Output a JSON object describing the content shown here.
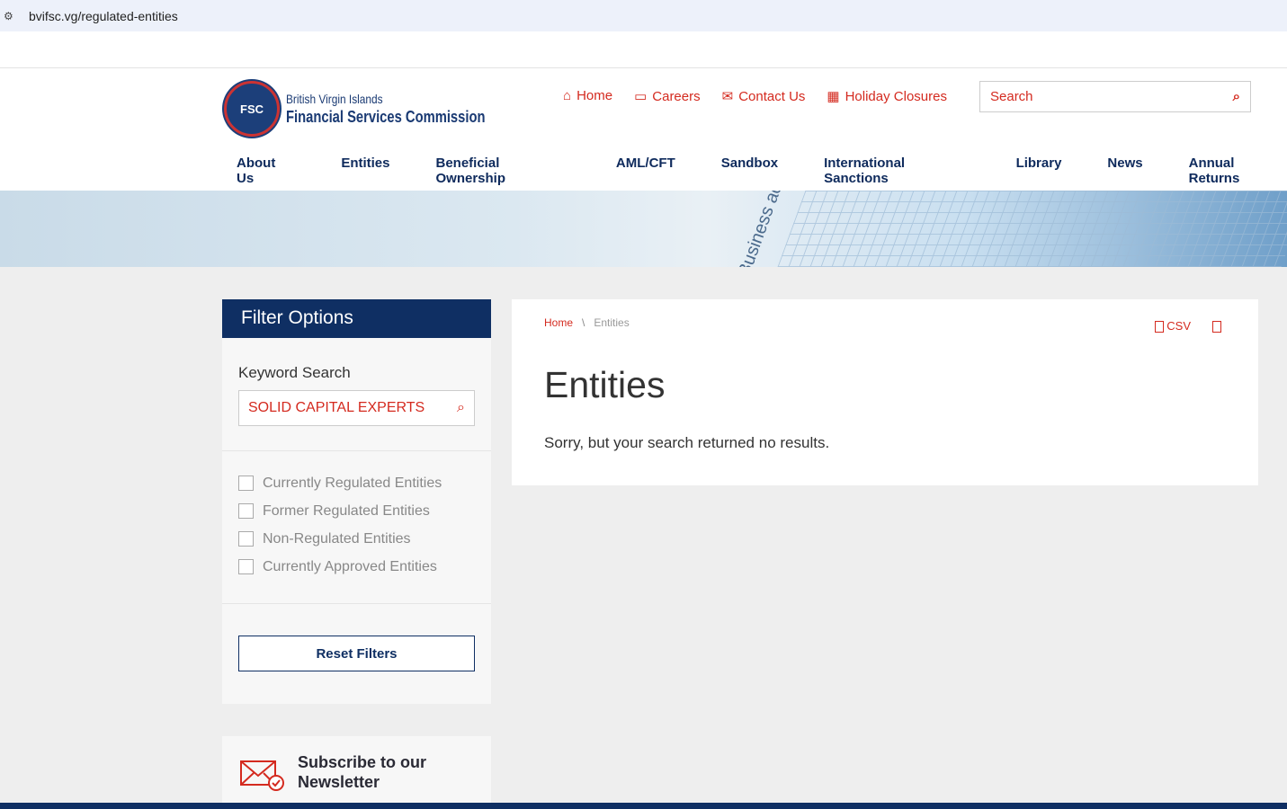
{
  "browser": {
    "url": "bvifsc.vg/regulated-entities"
  },
  "logo": {
    "seal": "FSC",
    "line1": "British Virgin Islands",
    "line2": "Financial Services Commission"
  },
  "top_links": [
    {
      "icon": "home-icon",
      "label": "Home"
    },
    {
      "icon": "briefcase-icon",
      "label": "Careers"
    },
    {
      "icon": "mail-icon",
      "label": "Contact Us"
    },
    {
      "icon": "calendar-icon",
      "label": "Holiday Closures"
    }
  ],
  "search": {
    "placeholder": "Search"
  },
  "nav": [
    "About Us",
    "Entities",
    "Beneficial Ownership",
    "AML/CFT",
    "Sandbox",
    "International Sanctions",
    "Library",
    "News",
    "Annual Returns"
  ],
  "banner": {
    "text": "Business act"
  },
  "filter": {
    "title": "Filter Options",
    "keyword_label": "Keyword Search",
    "keyword_value": "SOLID CAPITAL EXPERTS",
    "checkboxes": [
      "Currently Regulated Entities",
      "Former Regulated Entities",
      "Non-Regulated Entities",
      "Currently Approved Entities"
    ],
    "reset": "Reset Filters"
  },
  "newsletter": {
    "line1": "Subscribe to our",
    "line2": "Newsletter"
  },
  "main": {
    "breadcrumb": [
      "Home",
      "Entities"
    ],
    "breadcrumb_sep": "\\",
    "csv": "CSV",
    "title": "Entities",
    "message": "Sorry, but your search returned no results."
  },
  "colors": {
    "accent": "#d42a1f",
    "navy": "#0f2f63"
  }
}
